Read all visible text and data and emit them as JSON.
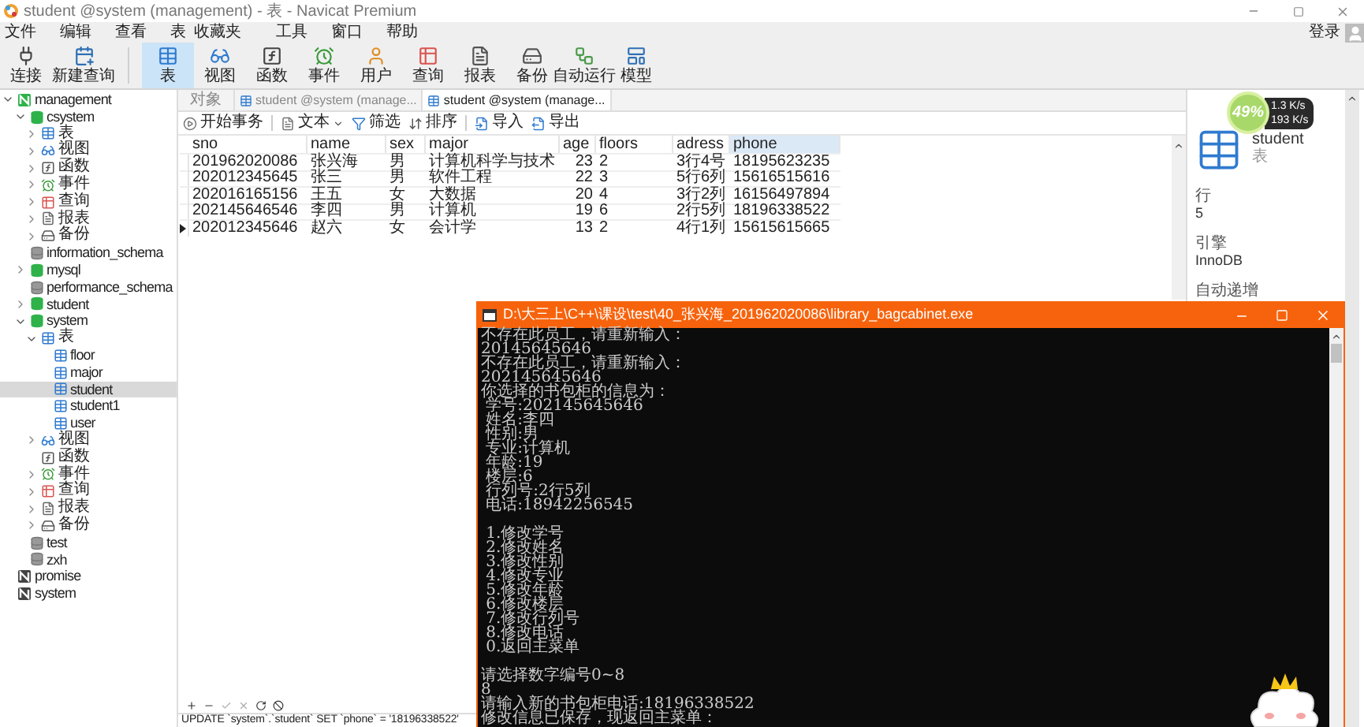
{
  "window": {
    "title": "student @system (management) - 表 - Navicat Premium"
  },
  "menu": [
    "文件",
    "编辑",
    "查看",
    "表",
    "收藏夹",
    "工具",
    "窗口",
    "帮助"
  ],
  "toolbar": [
    {
      "label": "连接",
      "selected": false
    },
    {
      "label": "新建查询",
      "selected": false
    },
    {
      "label": "表",
      "selected": true
    },
    {
      "label": "视图",
      "selected": false
    },
    {
      "label": "函数",
      "selected": false
    },
    {
      "label": "事件",
      "selected": false
    },
    {
      "label": "用户",
      "selected": false
    },
    {
      "label": "查询",
      "selected": false
    },
    {
      "label": "报表",
      "selected": false
    },
    {
      "label": "备份",
      "selected": false
    },
    {
      "label": "自动运行",
      "selected": false
    },
    {
      "label": "模型",
      "selected": false
    }
  ],
  "login": "登录",
  "tree": [
    {
      "label": "management",
      "kind": "connection",
      "open": true,
      "expanded": true,
      "selected": false,
      "children": [
        {
          "label": "csystem",
          "kind": "database",
          "open": true,
          "expanded": true,
          "selected": false,
          "children": [
            {
              "label": "表",
              "kind": "tables",
              "expanded": false,
              "selected": false
            },
            {
              "label": "视图",
              "kind": "views",
              "expanded": false,
              "selected": false
            },
            {
              "label": "函数",
              "kind": "functions",
              "expanded": false,
              "selected": false
            },
            {
              "label": "事件",
              "kind": "events",
              "expanded": false,
              "selected": false
            },
            {
              "label": "查询",
              "kind": "queries",
              "expanded": false,
              "selected": false
            },
            {
              "label": "报表",
              "kind": "reports",
              "expanded": false,
              "selected": false
            },
            {
              "label": "备份",
              "kind": "backups",
              "expanded": false,
              "selected": false
            }
          ]
        },
        {
          "label": "information_schema",
          "kind": "database",
          "open": false,
          "selected": false
        },
        {
          "label": "mysql",
          "kind": "database",
          "open": true,
          "expanded": false,
          "selected": false
        },
        {
          "label": "performance_schema",
          "kind": "database",
          "open": false,
          "selected": false
        },
        {
          "label": "student",
          "kind": "database",
          "open": true,
          "expanded": false,
          "selected": false
        },
        {
          "label": "system",
          "kind": "database",
          "open": true,
          "expanded": true,
          "selected": false,
          "children": [
            {
              "label": "表",
              "kind": "tables",
              "expanded": true,
              "selected": false,
              "children": [
                {
                  "label": "floor",
                  "kind": "table",
                  "selected": false
                },
                {
                  "label": "major",
                  "kind": "table",
                  "selected": false
                },
                {
                  "label": "student",
                  "kind": "table",
                  "selected": true
                },
                {
                  "label": "student1",
                  "kind": "table",
                  "selected": false
                },
                {
                  "label": "user",
                  "kind": "table",
                  "selected": false
                }
              ]
            },
            {
              "label": "视图",
              "kind": "views",
              "expanded": false,
              "selected": false
            },
            {
              "label": "函数",
              "kind": "functions",
              "selected": false
            },
            {
              "label": "事件",
              "kind": "events",
              "expanded": false,
              "selected": false
            },
            {
              "label": "查询",
              "kind": "queries",
              "expanded": false,
              "selected": false
            },
            {
              "label": "报表",
              "kind": "reports",
              "expanded": false,
              "selected": false
            },
            {
              "label": "备份",
              "kind": "backups",
              "expanded": false,
              "selected": false
            }
          ]
        },
        {
          "label": "test",
          "kind": "database",
          "open": false,
          "selected": false
        },
        {
          "label": "zxh",
          "kind": "database",
          "open": false,
          "selected": false
        }
      ]
    },
    {
      "label": "promise",
      "kind": "connection",
      "open": false,
      "selected": false
    },
    {
      "label": "system",
      "kind": "connection",
      "open": false,
      "selected": false
    }
  ],
  "tabs": [
    {
      "label": "对象",
      "selected": false
    },
    {
      "label": "student @system (manage...",
      "selected": false
    },
    {
      "label": "student @system (manage...",
      "selected": true
    }
  ],
  "table_toolbar": [
    "开始事务",
    "文本",
    "筛选",
    "排序",
    "导入",
    "导出"
  ],
  "table": {
    "columns": [
      {
        "label": "sno",
        "kind": "text",
        "selected": false
      },
      {
        "label": "name",
        "kind": "text",
        "selected": false
      },
      {
        "label": "sex",
        "kind": "text",
        "selected": false
      },
      {
        "label": "major",
        "kind": "text",
        "selected": false
      },
      {
        "label": "age",
        "kind": "number",
        "selected": false
      },
      {
        "label": "floors",
        "kind": "text",
        "selected": false
      },
      {
        "label": "adress",
        "kind": "text",
        "selected": false
      },
      {
        "label": "phone",
        "kind": "text",
        "selected": true
      }
    ],
    "rows": [
      {
        "current": false,
        "cells": [
          "201962020086",
          "张兴海",
          "男",
          "计算机科学与技术",
          "23",
          "2",
          "3行4号",
          "18195623235"
        ]
      },
      {
        "current": false,
        "cells": [
          "202012345645",
          "张三",
          "男",
          "软件工程",
          "22",
          "3",
          "5行6列",
          "15616515616"
        ]
      },
      {
        "current": false,
        "cells": [
          "202016165156",
          "王五",
          "女",
          "大数据",
          "20",
          "4",
          "3行2列",
          "16156497894"
        ]
      },
      {
        "current": false,
        "cells": [
          "202145646546",
          "李四",
          "男",
          "计算机",
          "19",
          "6",
          "2行5列",
          "18196338522"
        ]
      },
      {
        "current": true,
        "cells": [
          "202012345646",
          "赵六",
          "女",
          "会计学",
          "13",
          "2",
          "4行1列",
          "15615615665"
        ]
      }
    ]
  },
  "status_bar": "UPDATE `system`.`student` SET `phone` = '18196338522'",
  "info_panel": {
    "name": "student",
    "type": "表",
    "fields": [
      {
        "label": "行",
        "value": "5"
      },
      {
        "label": "引擎",
        "value": "InnoDB"
      },
      {
        "label": "自动递增"
      }
    ]
  },
  "gadget": {
    "percent": "49%",
    "upload": "1.3 K/s",
    "download": "193 K/s"
  },
  "console": {
    "title": "D:\\大三上\\C++\\课设\\test\\40_张兴海_201962020086\\library_bagcabinet.exe",
    "blocks": [
      [
        "不存在此员工，请重新输入：",
        "20145645646",
        "不存在此员工，请重新输入：",
        "202145645646",
        "你选择的书包柜的信息为：",
        " 学号:202145645646",
        " 姓名:李四",
        " 性别:男",
        " 专业:计算机",
        " 年龄:19",
        " 楼层:6",
        " 行列号:2行5列",
        " 电话:18942256545"
      ],
      [
        " 1.修改学号",
        " 2.修改姓名",
        " 3.修改性别",
        " 4.修改专业",
        " 5.修改年龄",
        " 6.修改楼层",
        " 7.修改行列号",
        " 8.修改电话",
        " 0.返回主菜单"
      ],
      [
        "请选择数字编号0~8",
        "8",
        "请输入新的书包柜电话:18196338522",
        "修改信息已保存，现返回主菜单："
      ]
    ]
  }
}
